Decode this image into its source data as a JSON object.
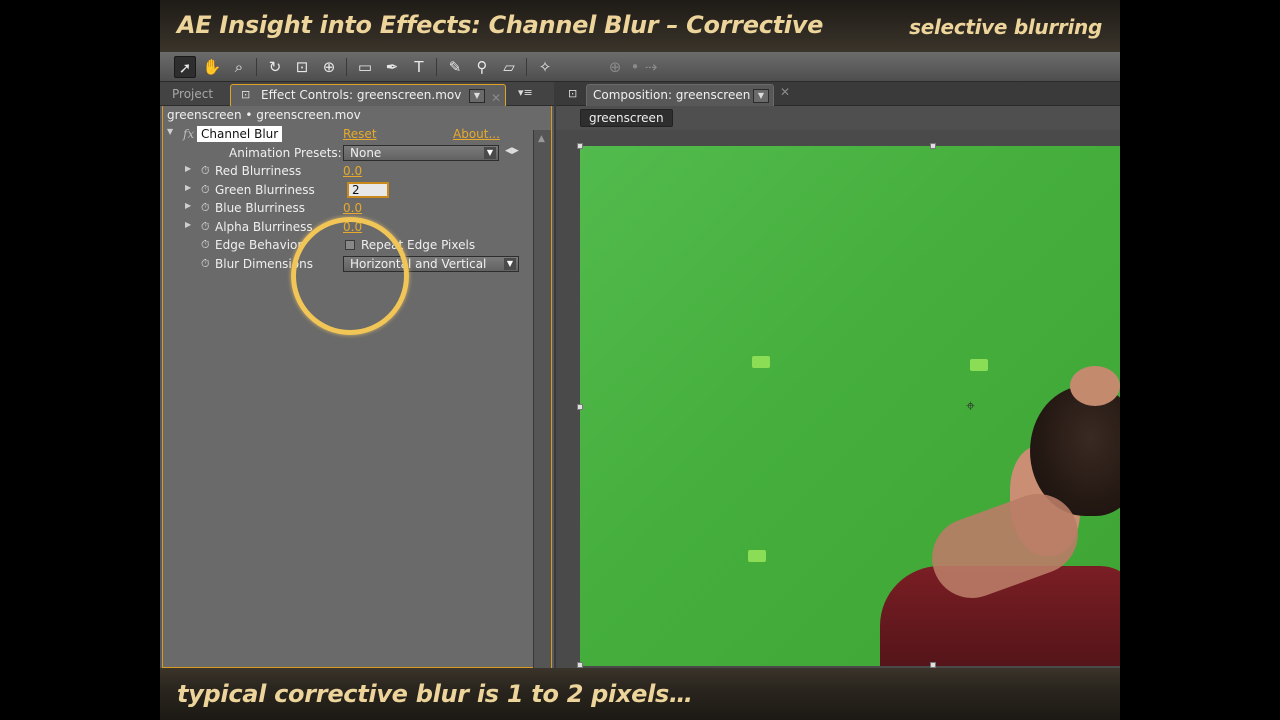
{
  "banner": {
    "title": "AE Insight into Effects: Channel Blur – Corrective",
    "subtitle": "selective blurring"
  },
  "toolbar": {
    "tools": [
      "selection-tool",
      "hand-tool",
      "zoom-tool",
      "rotate-tool",
      "camera-tool",
      "pan-behind-tool",
      "rectangle-tool",
      "pen-tool",
      "text-tool",
      "brush-tool",
      "clone-stamp-tool",
      "eraser-tool",
      "puppet-pin-tool"
    ],
    "text_tool_glyph": "T"
  },
  "left_panel": {
    "tabs": {
      "project": "Project",
      "effect_controls": "Effect Controls: greenscreen.mov"
    },
    "layer_path": "greenscreen • greenscreen.mov",
    "effect": {
      "fx_label": "fx",
      "name": "Channel Blur",
      "reset": "Reset",
      "about": "About..."
    },
    "animation_presets": {
      "label": "Animation Presets:",
      "value": "None"
    },
    "properties": {
      "red": {
        "label": "Red Blurriness",
        "value": "0.0"
      },
      "green": {
        "label": "Green Blurriness",
        "value": "2"
      },
      "blue": {
        "label": "Blue Blurriness",
        "value": "0.0"
      },
      "alpha": {
        "label": "Alpha Blurriness",
        "value": "0.0"
      },
      "edge": {
        "label": "Edge Behavior",
        "checkbox_label": "Repeat Edge Pixels"
      },
      "dimensions": {
        "label": "Blur Dimensions",
        "value": "Horizontal and Vertical"
      }
    }
  },
  "right_panel": {
    "tab": "Composition: greenscreen",
    "comp_button": "greenscreen"
  },
  "caption": "typical corrective blur is 1 to 2 pixels…",
  "colors": {
    "accent": "#e8a92a",
    "greenscreen": "#4cb545",
    "highlight_circle": "#f1c556",
    "banner_text": "#ecd49a"
  }
}
